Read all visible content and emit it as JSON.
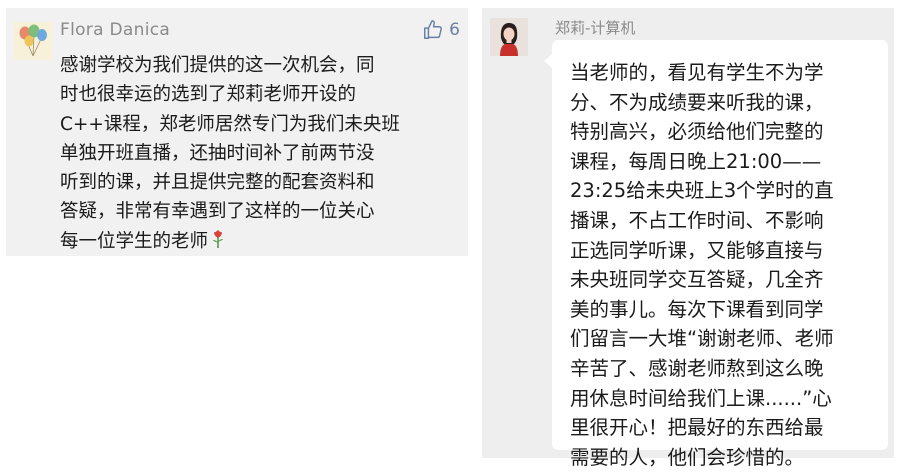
{
  "comment": {
    "author": "Flora Danica",
    "likes": "6",
    "lines": [
      "感谢学校为我们提供的这一次机会，同",
      "时也很幸运的选到了郑莉老师开设的",
      "C++课程，郑老师居然专门为我们未央班",
      "单独开班直播，还抽时间补了前两节没",
      "听到的课，并且提供完整的配套资料和",
      "答疑，非常有幸遇到了这样的一位关心",
      "每一位学生的老师"
    ],
    "emoji": "rose-emoji"
  },
  "reply": {
    "author": "郑莉-计算机",
    "lines": [
      "当老师的，看见有学生不为学",
      "分、不为成绩要来听我的课，",
      "特别高兴，必须给他们完整的",
      "课程，每周日晚上21:00——",
      "23:25给未央班上3个学时的直",
      "播课，不占工作时间、不影响",
      "正选同学听课，又能够直接与",
      "未央班同学交互答疑，几全齐",
      "美的事儿。每次下课看到同学",
      "们留言一大堆“谢谢老师、老师",
      "辛苦了、感谢老师熬到这么晚",
      "用休息时间给我们上课......”心",
      "里很开心！把最好的东西给最",
      "需要的人，他们会珍惜的。"
    ]
  },
  "icons": {
    "like": "thumbs-up-icon",
    "avatar_left": "balloons-avatar",
    "avatar_right": "person-avatar"
  },
  "colors": {
    "card_left_bg": "#f1f1f1",
    "card_right_bg": "#eeeeee",
    "like_color": "#6a7fa6",
    "meta_text": "#8a8a8a"
  }
}
